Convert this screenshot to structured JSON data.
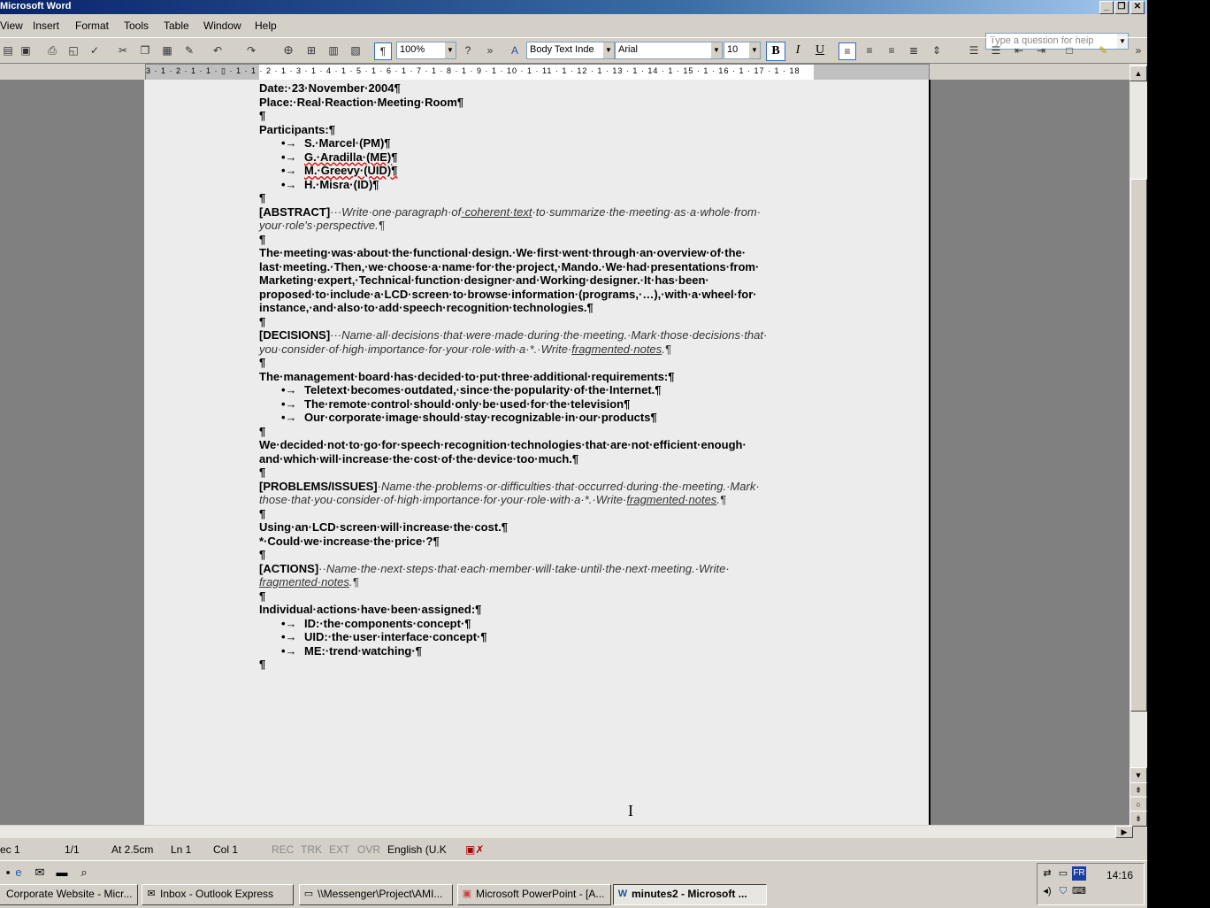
{
  "window": {
    "title": "Microsoft Word",
    "controls": [
      "_",
      "❐",
      "✕"
    ]
  },
  "menu": {
    "items": [
      "View",
      "Insert",
      "Format",
      "Tools",
      "Table",
      "Window",
      "Help"
    ],
    "ask_placeholder": "Type a question for help"
  },
  "toolbar": {
    "zoom": "100%",
    "style": "Body Text Inde",
    "font": "Arial",
    "size": "10",
    "bold": "B",
    "italic": "I",
    "underline": "U"
  },
  "ruler": {
    "ticks": "3 · 1 · 2 · 1 · 1 · ▯ · 1 · 1 · 2 · 1 · 3 · 1 · 4 · 1 · 5 · 1 · 6 · 1 · 7 · 1 · 8 · 1 · 9 · 1 · 10 · 1 · 11 · 1 · 12 · 1 · 13 · 1 · 14 · 1 · 15 · 1 · 16 · 1 · 17 · 1 · 18"
  },
  "document": {
    "date": "Date:·23·November·2004¶",
    "place": "Place:·Real·Reaction·Meeting·Room¶",
    "para_mark": "¶",
    "participants_heading": "Participants:¶",
    "participants": [
      "S.·Marcel·(PM)¶",
      "G.·Aradilla·(ME)¶",
      "M.·Greevy·(UID)¶",
      "H.·Misra·(ID)¶"
    ],
    "abstract_label": "[ABSTRACT]",
    "abstract_hint_1": "···Write·one·paragraph·of",
    "abstract_hint_link": "·coherent·text",
    "abstract_hint_2": "·to·summarize·the·meeting·as·a·whole·from·",
    "abstract_hint_3": "your·role's·perspective.¶",
    "abstract_lines": [
      "The·meeting·was·about·the·functional·design.·We·first·went·through·an·overview·of·the·",
      "last·meeting.·Then,·we·choose·a·name·for·the·project,·Mando.·We·had·presentations·from·",
      "Marketing·expert,·Technical·function·designer·and·Working·designer.·It·has·been·",
      "proposed·to·include·a·LCD·screen·to·browse·information·(programs,·…),·with·a·wheel·for·",
      "instance,·and·also·to·add·speech·recognition·technologies.¶"
    ],
    "decisions_label": "[DECISIONS]",
    "decisions_hint_1": "···Name·all·decisions·that·were·made·during·the·meeting.·Mark·those·decisions·that·",
    "decisions_hint_2": "you·consider·of·high·importance·for·your·role·with·a·*.·Write·",
    "decisions_hint_link": "fragmented·notes",
    "decisions_hint_end": ".¶",
    "decisions_intro": "The·management·board·has·decided·to·put·three·additional·requirements:¶",
    "decisions_items": [
      "Teletext·becomes·outdated,·since·the·popularity·of·the·Internet.¶",
      "The·remote·control·should·only·be·used·for·the·television¶",
      "Our·corporate·image·should·stay·recognizable·in·our·products¶"
    ],
    "decisions_text_1": "We·decided·not·to·go·for·speech·recognition·technologies·that·are·not·efficient·enough·",
    "decisions_text_2": "and·which·will·increase·the·cost·of·the·device·too·much.¶",
    "problems_label": "[PROBLEMS/ISSUES]",
    "problems_hint_1": "·Name·the·problems·or·difficulties·that·occurred·during·the·meeting.·Mark·",
    "problems_hint_2": "those·that·you·consider·of·high·importance·for·your·role·with·a·*.·Write·",
    "problems_hint_link": "fragmented·notes",
    "problems_hint_end": ".¶",
    "problems_text_1": "Using·an·LCD·screen·will·increase·the·cost.¶",
    "problems_text_2": "*·Could·we·increase·the·price·?¶",
    "actions_label": "[ACTIONS]",
    "actions_hint_1": "··Name·the·next·steps·that·each·member·will·take·until·the·next·meeting.·Write·",
    "actions_hint_link": "fragmented·notes",
    "actions_hint_end": ".¶",
    "actions_intro": "Individual·actions·have·been·assigned:¶",
    "actions_items": [
      "ID:·the·components·concept·¶",
      "UID:·the·user·interface·concept·¶",
      "ME:·trend·watching·¶"
    ],
    "bullet": "•→"
  },
  "status": {
    "sec": "ec 1",
    "page": "1/1",
    "at": "At 2.5cm",
    "ln": "Ln 1",
    "col": "Col 1",
    "rec": "REC",
    "trk": "TRK",
    "ext": "EXT",
    "ovr": "OVR",
    "lang": "English (U.K"
  },
  "taskbar": {
    "tasks": [
      "Corporate Website - Micr...",
      "Inbox - Outlook Express",
      "\\\\Messenger\\Project\\AMI...",
      "Microsoft PowerPoint - [A...",
      "minutes2 - Microsoft ..."
    ],
    "lang_indicator": "FR",
    "clock": "14:16"
  }
}
